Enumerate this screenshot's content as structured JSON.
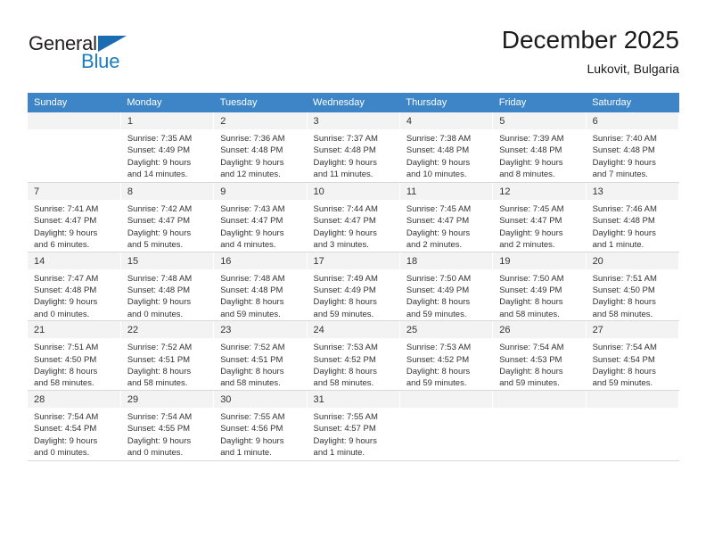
{
  "logo": {
    "word_dark": "General",
    "word_blue": "Blue",
    "triangle_color": "#1b6cb0",
    "blue_color": "#1b7cc4"
  },
  "header": {
    "month_title": "December 2025",
    "location": "Lukovit, Bulgaria"
  },
  "theme": {
    "header_row_bg": "#3d85c6",
    "header_row_text": "#ffffff",
    "daynum_bg": "#f3f3f3",
    "cell_text": "#333333",
    "row_divider": "#d9d9d9"
  },
  "weekdays": [
    "Sunday",
    "Monday",
    "Tuesday",
    "Wednesday",
    "Thursday",
    "Friday",
    "Saturday"
  ],
  "weeks": [
    [
      {
        "day": "",
        "lines": [
          "",
          "",
          "",
          ""
        ]
      },
      {
        "day": "1",
        "lines": [
          "Sunrise: 7:35 AM",
          "Sunset: 4:49 PM",
          "Daylight: 9 hours",
          "and 14 minutes."
        ]
      },
      {
        "day": "2",
        "lines": [
          "Sunrise: 7:36 AM",
          "Sunset: 4:48 PM",
          "Daylight: 9 hours",
          "and 12 minutes."
        ]
      },
      {
        "day": "3",
        "lines": [
          "Sunrise: 7:37 AM",
          "Sunset: 4:48 PM",
          "Daylight: 9 hours",
          "and 11 minutes."
        ]
      },
      {
        "day": "4",
        "lines": [
          "Sunrise: 7:38 AM",
          "Sunset: 4:48 PM",
          "Daylight: 9 hours",
          "and 10 minutes."
        ]
      },
      {
        "day": "5",
        "lines": [
          "Sunrise: 7:39 AM",
          "Sunset: 4:48 PM",
          "Daylight: 9 hours",
          "and 8 minutes."
        ]
      },
      {
        "day": "6",
        "lines": [
          "Sunrise: 7:40 AM",
          "Sunset: 4:48 PM",
          "Daylight: 9 hours",
          "and 7 minutes."
        ]
      }
    ],
    [
      {
        "day": "7",
        "lines": [
          "Sunrise: 7:41 AM",
          "Sunset: 4:47 PM",
          "Daylight: 9 hours",
          "and 6 minutes."
        ]
      },
      {
        "day": "8",
        "lines": [
          "Sunrise: 7:42 AM",
          "Sunset: 4:47 PM",
          "Daylight: 9 hours",
          "and 5 minutes."
        ]
      },
      {
        "day": "9",
        "lines": [
          "Sunrise: 7:43 AM",
          "Sunset: 4:47 PM",
          "Daylight: 9 hours",
          "and 4 minutes."
        ]
      },
      {
        "day": "10",
        "lines": [
          "Sunrise: 7:44 AM",
          "Sunset: 4:47 PM",
          "Daylight: 9 hours",
          "and 3 minutes."
        ]
      },
      {
        "day": "11",
        "lines": [
          "Sunrise: 7:45 AM",
          "Sunset: 4:47 PM",
          "Daylight: 9 hours",
          "and 2 minutes."
        ]
      },
      {
        "day": "12",
        "lines": [
          "Sunrise: 7:45 AM",
          "Sunset: 4:47 PM",
          "Daylight: 9 hours",
          "and 2 minutes."
        ]
      },
      {
        "day": "13",
        "lines": [
          "Sunrise: 7:46 AM",
          "Sunset: 4:48 PM",
          "Daylight: 9 hours",
          "and 1 minute."
        ]
      }
    ],
    [
      {
        "day": "14",
        "lines": [
          "Sunrise: 7:47 AM",
          "Sunset: 4:48 PM",
          "Daylight: 9 hours",
          "and 0 minutes."
        ]
      },
      {
        "day": "15",
        "lines": [
          "Sunrise: 7:48 AM",
          "Sunset: 4:48 PM",
          "Daylight: 9 hours",
          "and 0 minutes."
        ]
      },
      {
        "day": "16",
        "lines": [
          "Sunrise: 7:48 AM",
          "Sunset: 4:48 PM",
          "Daylight: 8 hours",
          "and 59 minutes."
        ]
      },
      {
        "day": "17",
        "lines": [
          "Sunrise: 7:49 AM",
          "Sunset: 4:49 PM",
          "Daylight: 8 hours",
          "and 59 minutes."
        ]
      },
      {
        "day": "18",
        "lines": [
          "Sunrise: 7:50 AM",
          "Sunset: 4:49 PM",
          "Daylight: 8 hours",
          "and 59 minutes."
        ]
      },
      {
        "day": "19",
        "lines": [
          "Sunrise: 7:50 AM",
          "Sunset: 4:49 PM",
          "Daylight: 8 hours",
          "and 58 minutes."
        ]
      },
      {
        "day": "20",
        "lines": [
          "Sunrise: 7:51 AM",
          "Sunset: 4:50 PM",
          "Daylight: 8 hours",
          "and 58 minutes."
        ]
      }
    ],
    [
      {
        "day": "21",
        "lines": [
          "Sunrise: 7:51 AM",
          "Sunset: 4:50 PM",
          "Daylight: 8 hours",
          "and 58 minutes."
        ]
      },
      {
        "day": "22",
        "lines": [
          "Sunrise: 7:52 AM",
          "Sunset: 4:51 PM",
          "Daylight: 8 hours",
          "and 58 minutes."
        ]
      },
      {
        "day": "23",
        "lines": [
          "Sunrise: 7:52 AM",
          "Sunset: 4:51 PM",
          "Daylight: 8 hours",
          "and 58 minutes."
        ]
      },
      {
        "day": "24",
        "lines": [
          "Sunrise: 7:53 AM",
          "Sunset: 4:52 PM",
          "Daylight: 8 hours",
          "and 58 minutes."
        ]
      },
      {
        "day": "25",
        "lines": [
          "Sunrise: 7:53 AM",
          "Sunset: 4:52 PM",
          "Daylight: 8 hours",
          "and 59 minutes."
        ]
      },
      {
        "day": "26",
        "lines": [
          "Sunrise: 7:54 AM",
          "Sunset: 4:53 PM",
          "Daylight: 8 hours",
          "and 59 minutes."
        ]
      },
      {
        "day": "27",
        "lines": [
          "Sunrise: 7:54 AM",
          "Sunset: 4:54 PM",
          "Daylight: 8 hours",
          "and 59 minutes."
        ]
      }
    ],
    [
      {
        "day": "28",
        "lines": [
          "Sunrise: 7:54 AM",
          "Sunset: 4:54 PM",
          "Daylight: 9 hours",
          "and 0 minutes."
        ]
      },
      {
        "day": "29",
        "lines": [
          "Sunrise: 7:54 AM",
          "Sunset: 4:55 PM",
          "Daylight: 9 hours",
          "and 0 minutes."
        ]
      },
      {
        "day": "30",
        "lines": [
          "Sunrise: 7:55 AM",
          "Sunset: 4:56 PM",
          "Daylight: 9 hours",
          "and 1 minute."
        ]
      },
      {
        "day": "31",
        "lines": [
          "Sunrise: 7:55 AM",
          "Sunset: 4:57 PM",
          "Daylight: 9 hours",
          "and 1 minute."
        ]
      },
      {
        "day": "",
        "lines": [
          "",
          "",
          "",
          ""
        ]
      },
      {
        "day": "",
        "lines": [
          "",
          "",
          "",
          ""
        ]
      },
      {
        "day": "",
        "lines": [
          "",
          "",
          "",
          ""
        ]
      }
    ]
  ]
}
